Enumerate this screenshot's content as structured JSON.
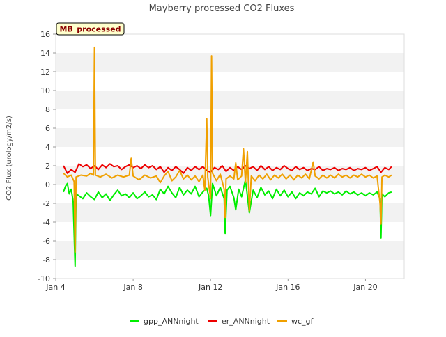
{
  "chart_data": {
    "type": "line",
    "title": "Mayberry processed CO2 Fluxes",
    "ylabel": "CO2 Flux (urology/m2/s)",
    "xlabel": "",
    "badge": "MB_processed",
    "ylim": [
      -10,
      16
    ],
    "yticks": [
      -10,
      -8,
      -6,
      -4,
      -2,
      0,
      2,
      4,
      6,
      8,
      10,
      12,
      14,
      16
    ],
    "xlim_days": [
      4,
      22
    ],
    "xticks": [
      {
        "day": 4,
        "label": "Jan 4"
      },
      {
        "day": 8,
        "label": "Jan 8"
      },
      {
        "day": 12,
        "label": "Jan 12"
      },
      {
        "day": 16,
        "label": "Jan 16"
      },
      {
        "day": 20,
        "label": "Jan 20"
      }
    ],
    "grid": "horizontal-bands",
    "legend_position": "bottom",
    "series": [
      {
        "name": "gpp_ANNnight",
        "color": "#00ee00",
        "points": [
          [
            4.4,
            -0.8
          ],
          [
            4.5,
            -0.2
          ],
          [
            4.6,
            0.1
          ],
          [
            4.7,
            -1.0
          ],
          [
            4.8,
            -0.5
          ],
          [
            4.9,
            -1.8
          ],
          [
            5.0,
            -8.7
          ],
          [
            5.05,
            -1.0
          ],
          [
            5.2,
            -1.2
          ],
          [
            5.4,
            -1.5
          ],
          [
            5.6,
            -0.9
          ],
          [
            5.8,
            -1.3
          ],
          [
            6.0,
            -1.6
          ],
          [
            6.2,
            -0.8
          ],
          [
            6.4,
            -1.4
          ],
          [
            6.6,
            -1.0
          ],
          [
            6.8,
            -1.7
          ],
          [
            7.0,
            -1.1
          ],
          [
            7.2,
            -0.6
          ],
          [
            7.4,
            -1.2
          ],
          [
            7.6,
            -1.0
          ],
          [
            7.8,
            -1.4
          ],
          [
            8.0,
            -0.9
          ],
          [
            8.2,
            -1.5
          ],
          [
            8.4,
            -1.2
          ],
          [
            8.6,
            -0.8
          ],
          [
            8.8,
            -1.3
          ],
          [
            9.0,
            -1.1
          ],
          [
            9.2,
            -1.6
          ],
          [
            9.4,
            -0.5
          ],
          [
            9.6,
            -1.0
          ],
          [
            9.8,
            -0.2
          ],
          [
            10.0,
            -0.9
          ],
          [
            10.2,
            -1.4
          ],
          [
            10.4,
            -0.3
          ],
          [
            10.6,
            -1.1
          ],
          [
            10.8,
            -0.6
          ],
          [
            11.0,
            -1.0
          ],
          [
            11.2,
            -0.2
          ],
          [
            11.4,
            -1.3
          ],
          [
            11.6,
            -0.8
          ],
          [
            11.8,
            -0.4
          ],
          [
            11.9,
            -1.2
          ],
          [
            12.0,
            -3.3
          ],
          [
            12.1,
            0.1
          ],
          [
            12.3,
            -1.2
          ],
          [
            12.5,
            -0.3
          ],
          [
            12.7,
            -1.5
          ],
          [
            12.75,
            -5.2
          ],
          [
            12.85,
            -0.6
          ],
          [
            13.0,
            -0.2
          ],
          [
            13.2,
            -1.4
          ],
          [
            13.3,
            -2.7
          ],
          [
            13.45,
            -0.5
          ],
          [
            13.6,
            -1.3
          ],
          [
            13.8,
            0.5
          ],
          [
            13.9,
            -1.2
          ],
          [
            14.0,
            -3.0
          ],
          [
            14.2,
            -0.6
          ],
          [
            14.4,
            -1.4
          ],
          [
            14.6,
            -0.3
          ],
          [
            14.8,
            -1.1
          ],
          [
            15.0,
            -0.7
          ],
          [
            15.2,
            -1.5
          ],
          [
            15.4,
            -0.5
          ],
          [
            15.6,
            -1.2
          ],
          [
            15.8,
            -0.6
          ],
          [
            16.0,
            -1.3
          ],
          [
            16.2,
            -0.8
          ],
          [
            16.4,
            -1.5
          ],
          [
            16.6,
            -0.9
          ],
          [
            16.8,
            -1.2
          ],
          [
            17.0,
            -0.8
          ],
          [
            17.2,
            -1.0
          ],
          [
            17.4,
            -0.4
          ],
          [
            17.6,
            -1.3
          ],
          [
            17.8,
            -0.7
          ],
          [
            18.0,
            -0.9
          ],
          [
            18.2,
            -0.7
          ],
          [
            18.4,
            -1.0
          ],
          [
            18.6,
            -0.8
          ],
          [
            18.8,
            -1.1
          ],
          [
            19.0,
            -0.7
          ],
          [
            19.2,
            -1.0
          ],
          [
            19.4,
            -0.8
          ],
          [
            19.6,
            -1.1
          ],
          [
            19.8,
            -0.9
          ],
          [
            20.0,
            -1.2
          ],
          [
            20.2,
            -0.9
          ],
          [
            20.4,
            -1.1
          ],
          [
            20.6,
            -0.8
          ],
          [
            20.75,
            -1.5
          ],
          [
            20.8,
            -5.7
          ],
          [
            20.85,
            -1.0
          ],
          [
            21.0,
            -1.3
          ],
          [
            21.2,
            -0.9
          ],
          [
            21.35,
            -0.8
          ]
        ]
      },
      {
        "name": "er_ANNnight",
        "color": "#ee0000",
        "points": [
          [
            4.4,
            2.0
          ],
          [
            4.6,
            1.2
          ],
          [
            4.8,
            1.6
          ],
          [
            5.0,
            1.3
          ],
          [
            5.2,
            2.2
          ],
          [
            5.4,
            1.9
          ],
          [
            5.6,
            2.1
          ],
          [
            5.8,
            1.7
          ],
          [
            6.0,
            2.0
          ],
          [
            6.2,
            1.6
          ],
          [
            6.4,
            2.1
          ],
          [
            6.6,
            1.8
          ],
          [
            6.8,
            2.2
          ],
          [
            7.0,
            1.9
          ],
          [
            7.2,
            2.0
          ],
          [
            7.4,
            1.6
          ],
          [
            7.6,
            1.9
          ],
          [
            7.8,
            2.1
          ],
          [
            8.0,
            1.8
          ],
          [
            8.2,
            2.0
          ],
          [
            8.4,
            1.7
          ],
          [
            8.6,
            2.1
          ],
          [
            8.8,
            1.8
          ],
          [
            9.0,
            2.0
          ],
          [
            9.2,
            1.6
          ],
          [
            9.4,
            1.9
          ],
          [
            9.6,
            1.3
          ],
          [
            9.8,
            1.8
          ],
          [
            10.0,
            1.5
          ],
          [
            10.2,
            1.9
          ],
          [
            10.4,
            1.6
          ],
          [
            10.6,
            1.2
          ],
          [
            10.8,
            1.8
          ],
          [
            11.0,
            1.5
          ],
          [
            11.2,
            1.9
          ],
          [
            11.4,
            1.6
          ],
          [
            11.6,
            1.9
          ],
          [
            11.8,
            1.5
          ],
          [
            12.0,
            1.3
          ],
          [
            12.2,
            1.8
          ],
          [
            12.4,
            1.6
          ],
          [
            12.6,
            2.0
          ],
          [
            12.8,
            1.4
          ],
          [
            13.0,
            1.8
          ],
          [
            13.2,
            1.5
          ],
          [
            13.4,
            1.9
          ],
          [
            13.6,
            1.6
          ],
          [
            13.8,
            2.0
          ],
          [
            14.0,
            1.7
          ],
          [
            14.2,
            1.9
          ],
          [
            14.4,
            1.5
          ],
          [
            14.6,
            2.0
          ],
          [
            14.8,
            1.6
          ],
          [
            15.0,
            1.9
          ],
          [
            15.2,
            1.5
          ],
          [
            15.4,
            1.8
          ],
          [
            15.6,
            1.6
          ],
          [
            15.8,
            2.0
          ],
          [
            16.0,
            1.7
          ],
          [
            16.2,
            1.5
          ],
          [
            16.4,
            1.9
          ],
          [
            16.6,
            1.6
          ],
          [
            16.8,
            1.8
          ],
          [
            17.0,
            1.5
          ],
          [
            17.2,
            1.7
          ],
          [
            17.4,
            1.6
          ],
          [
            17.6,
            1.9
          ],
          [
            17.8,
            1.5
          ],
          [
            18.0,
            1.7
          ],
          [
            18.2,
            1.6
          ],
          [
            18.4,
            1.8
          ],
          [
            18.6,
            1.5
          ],
          [
            18.8,
            1.7
          ],
          [
            19.0,
            1.6
          ],
          [
            19.2,
            1.8
          ],
          [
            19.4,
            1.5
          ],
          [
            19.6,
            1.7
          ],
          [
            19.8,
            1.6
          ],
          [
            20.0,
            1.8
          ],
          [
            20.2,
            1.5
          ],
          [
            20.4,
            1.7
          ],
          [
            20.6,
            1.9
          ],
          [
            20.8,
            1.3
          ],
          [
            21.0,
            1.8
          ],
          [
            21.2,
            1.6
          ],
          [
            21.35,
            1.9
          ]
        ]
      },
      {
        "name": "wc_gf",
        "color": "#f0a000",
        "points": [
          [
            4.4,
            1.2
          ],
          [
            4.6,
            0.8
          ],
          [
            4.8,
            1.0
          ],
          [
            4.95,
            0.3
          ],
          [
            5.0,
            -7.2
          ],
          [
            5.05,
            0.8
          ],
          [
            5.3,
            1.0
          ],
          [
            5.6,
            0.9
          ],
          [
            5.8,
            1.2
          ],
          [
            5.95,
            1.0
          ],
          [
            6.0,
            14.6
          ],
          [
            6.05,
            1.0
          ],
          [
            6.3,
            0.8
          ],
          [
            6.6,
            1.1
          ],
          [
            6.9,
            0.7
          ],
          [
            7.2,
            1.0
          ],
          [
            7.5,
            0.8
          ],
          [
            7.8,
            1.0
          ],
          [
            7.9,
            2.8
          ],
          [
            8.0,
            0.9
          ],
          [
            8.3,
            0.5
          ],
          [
            8.6,
            1.0
          ],
          [
            8.9,
            0.7
          ],
          [
            9.2,
            0.9
          ],
          [
            9.4,
            0.2
          ],
          [
            9.6,
            0.9
          ],
          [
            9.8,
            1.4
          ],
          [
            10.0,
            0.4
          ],
          [
            10.2,
            0.8
          ],
          [
            10.4,
            1.5
          ],
          [
            10.6,
            0.6
          ],
          [
            10.8,
            1.0
          ],
          [
            11.0,
            0.5
          ],
          [
            11.2,
            0.9
          ],
          [
            11.4,
            0.3
          ],
          [
            11.6,
            1.0
          ],
          [
            11.7,
            -0.6
          ],
          [
            11.8,
            7.0
          ],
          [
            11.85,
            0.8
          ],
          [
            12.0,
            -1.5
          ],
          [
            12.05,
            13.7
          ],
          [
            12.1,
            1.2
          ],
          [
            12.3,
            0.4
          ],
          [
            12.5,
            1.1
          ],
          [
            12.7,
            -0.5
          ],
          [
            12.75,
            -3.5
          ],
          [
            12.8,
            0.6
          ],
          [
            13.0,
            0.9
          ],
          [
            13.2,
            0.6
          ],
          [
            13.3,
            2.3
          ],
          [
            13.4,
            0.5
          ],
          [
            13.6,
            0.9
          ],
          [
            13.7,
            3.8
          ],
          [
            13.8,
            0.2
          ],
          [
            13.9,
            3.5
          ],
          [
            14.0,
            -2.8
          ],
          [
            14.1,
            0.9
          ],
          [
            14.3,
            0.4
          ],
          [
            14.5,
            1.0
          ],
          [
            14.7,
            0.6
          ],
          [
            14.9,
            1.1
          ],
          [
            15.1,
            0.5
          ],
          [
            15.3,
            1.0
          ],
          [
            15.5,
            0.7
          ],
          [
            15.7,
            1.1
          ],
          [
            15.9,
            0.6
          ],
          [
            16.1,
            1.0
          ],
          [
            16.3,
            0.5
          ],
          [
            16.5,
            1.0
          ],
          [
            16.7,
            0.7
          ],
          [
            16.9,
            1.1
          ],
          [
            17.1,
            0.6
          ],
          [
            17.3,
            2.4
          ],
          [
            17.4,
            0.9
          ],
          [
            17.6,
            0.6
          ],
          [
            17.8,
            1.0
          ],
          [
            18.0,
            0.7
          ],
          [
            18.2,
            1.0
          ],
          [
            18.4,
            0.7
          ],
          [
            18.6,
            1.1
          ],
          [
            18.8,
            0.8
          ],
          [
            19.0,
            1.0
          ],
          [
            19.2,
            0.7
          ],
          [
            19.4,
            1.0
          ],
          [
            19.6,
            0.8
          ],
          [
            19.8,
            1.1
          ],
          [
            20.0,
            0.8
          ],
          [
            20.2,
            1.0
          ],
          [
            20.4,
            0.7
          ],
          [
            20.6,
            0.9
          ],
          [
            20.75,
            -2.0
          ],
          [
            20.8,
            -4.2
          ],
          [
            20.85,
            0.8
          ],
          [
            21.0,
            1.0
          ],
          [
            21.2,
            0.8
          ],
          [
            21.35,
            1.0
          ]
        ]
      }
    ]
  }
}
